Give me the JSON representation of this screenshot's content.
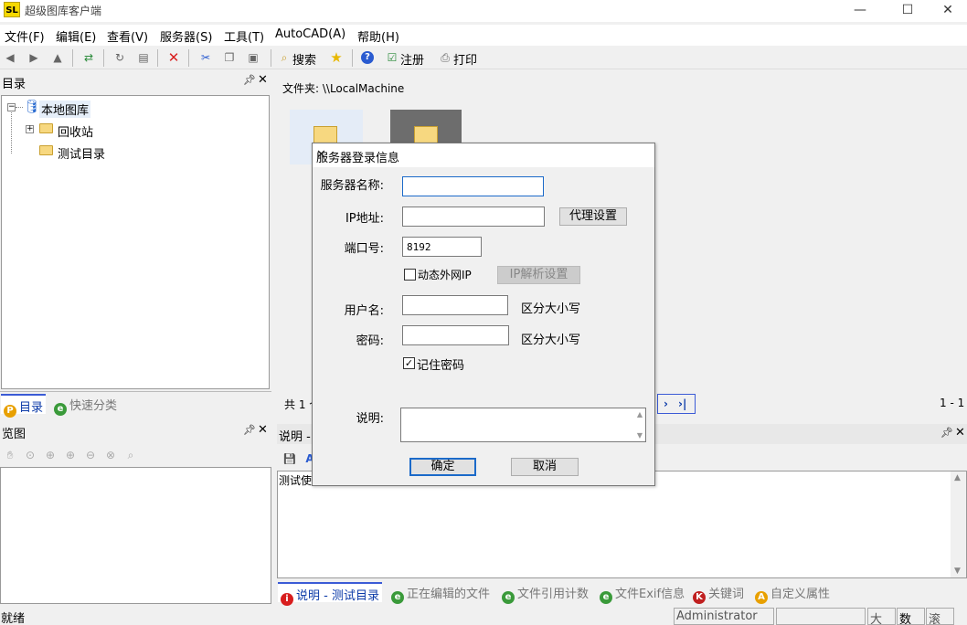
{
  "app": {
    "logo": "SL",
    "title": "超级图库客户端",
    "min": "—",
    "max": "☐",
    "close": "✕"
  },
  "menu": [
    "文件(F)",
    "编辑(E)",
    "查看(V)",
    "服务器(S)",
    "工具(T)",
    "AutoCAD(A)",
    "帮助(H)"
  ],
  "toolbar": {
    "search": "搜索",
    "register": "注册",
    "print": "打印"
  },
  "catalog": {
    "title": "目录",
    "root": "本地图库",
    "items": [
      "回收站",
      "测试目录"
    ],
    "tabs": [
      "目录",
      "快速分类"
    ]
  },
  "folder_path": "文件夹: \\\\LocalMachine",
  "count_text": "共 1 个",
  "page_range": "1 - 1",
  "preview": {
    "title": "览图"
  },
  "desc": {
    "title": "说明 -",
    "text": "测试使",
    "tabs": [
      "说明 - 测试目录",
      "正在编辑的文件",
      "文件引用计数",
      "文件Exif信息",
      "关键词",
      "自定义属性"
    ]
  },
  "status": {
    "ready": "就绪",
    "user": "Administrator",
    "caps": "大写",
    "num": "数字",
    "scroll": "滚动"
  },
  "dialog": {
    "title": "服务器登录信息",
    "server_name_label": "服务器名称:",
    "server_name_value": "",
    "ip_label": "IP地址:",
    "ip_value": "",
    "proxy_button": "代理设置",
    "port_label": "端口号:",
    "port_value": "8192",
    "dynamic_ip_label": "动态外网IP",
    "dynamic_ip_checked": false,
    "ip_parse_button": "IP解析设置",
    "username_label": "用户名:",
    "username_value": "",
    "case_note": "区分大小写",
    "password_label": "密码:",
    "password_value": "",
    "remember_label": "记住密码",
    "remember_checked": true,
    "desc_label": "说明:",
    "ok_button": "确定",
    "cancel_button": "取消"
  }
}
